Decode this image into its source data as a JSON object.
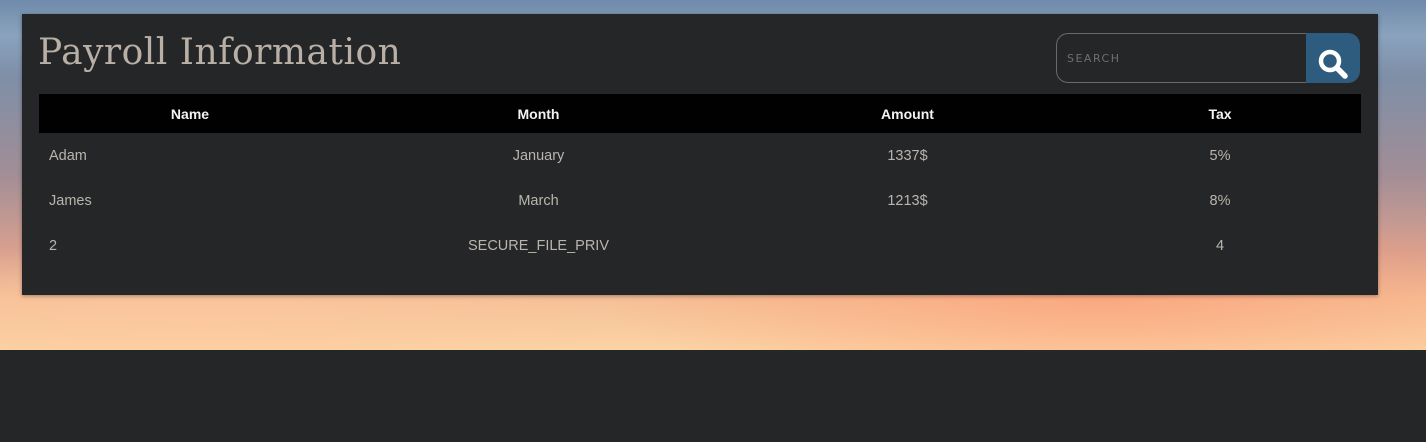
{
  "page": {
    "title": "Payroll Information"
  },
  "search": {
    "placeholder": "SEARCH",
    "button_icon": "search-icon",
    "button_color": "#2e5c7e"
  },
  "table": {
    "columns": [
      "Name",
      "Month",
      "Amount",
      "Tax"
    ],
    "rows": [
      [
        "Adam",
        "January",
        "1337$",
        "5%"
      ],
      [
        "James",
        "March",
        "1213$",
        "8%"
      ],
      [
        "2",
        "SECURE_FILE_PRIV",
        "",
        "4"
      ]
    ]
  },
  "colors": {
    "panel_background": "#252628",
    "header_background": "#010101",
    "title_text": "#b8b0a6"
  }
}
